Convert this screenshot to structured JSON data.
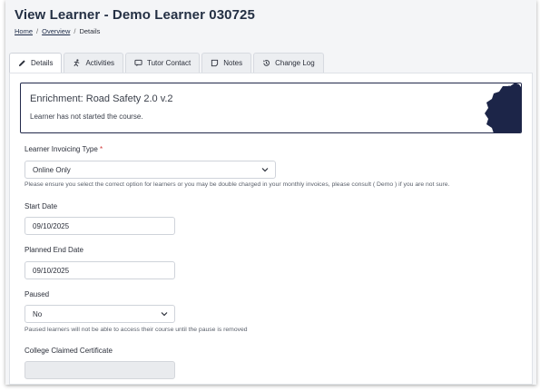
{
  "page": {
    "title": "View Learner - Demo Learner 030725",
    "breadcrumb": [
      "Home",
      "Overview",
      "Details"
    ]
  },
  "tabs": [
    {
      "label": "Details",
      "icon": "pencil-icon",
      "active": true
    },
    {
      "label": "Activities",
      "icon": "activity-icon",
      "active": false
    },
    {
      "label": "Tutor Contact",
      "icon": "chat-icon",
      "active": false
    },
    {
      "label": "Notes",
      "icon": "note-icon",
      "active": false
    },
    {
      "label": "Change Log",
      "icon": "history-icon",
      "active": false
    }
  ],
  "course": {
    "title": "Enrichment: Road Safety 2.0 v.2",
    "status": "Learner has not started the course.",
    "badge_color": "#1c2548"
  },
  "form": {
    "invoicing": {
      "label": "Learner Invoicing Type",
      "required_mark": "*",
      "value": "Online Only",
      "help": "Please ensure you select the correct option for learners or you may be double charged in your monthly invoices, please consult ( Demo ) if you are not sure."
    },
    "start_date": {
      "label": "Start Date",
      "value": "09/10/2025"
    },
    "planned_end_date": {
      "label": "Planned End Date",
      "value": "09/10/2025"
    },
    "paused": {
      "label": "Paused",
      "value": "No",
      "help": "Paused learners will not be able to access their course until the pause is removed"
    },
    "college_certificate": {
      "label": "College Claimed Certificate",
      "value": ""
    }
  }
}
